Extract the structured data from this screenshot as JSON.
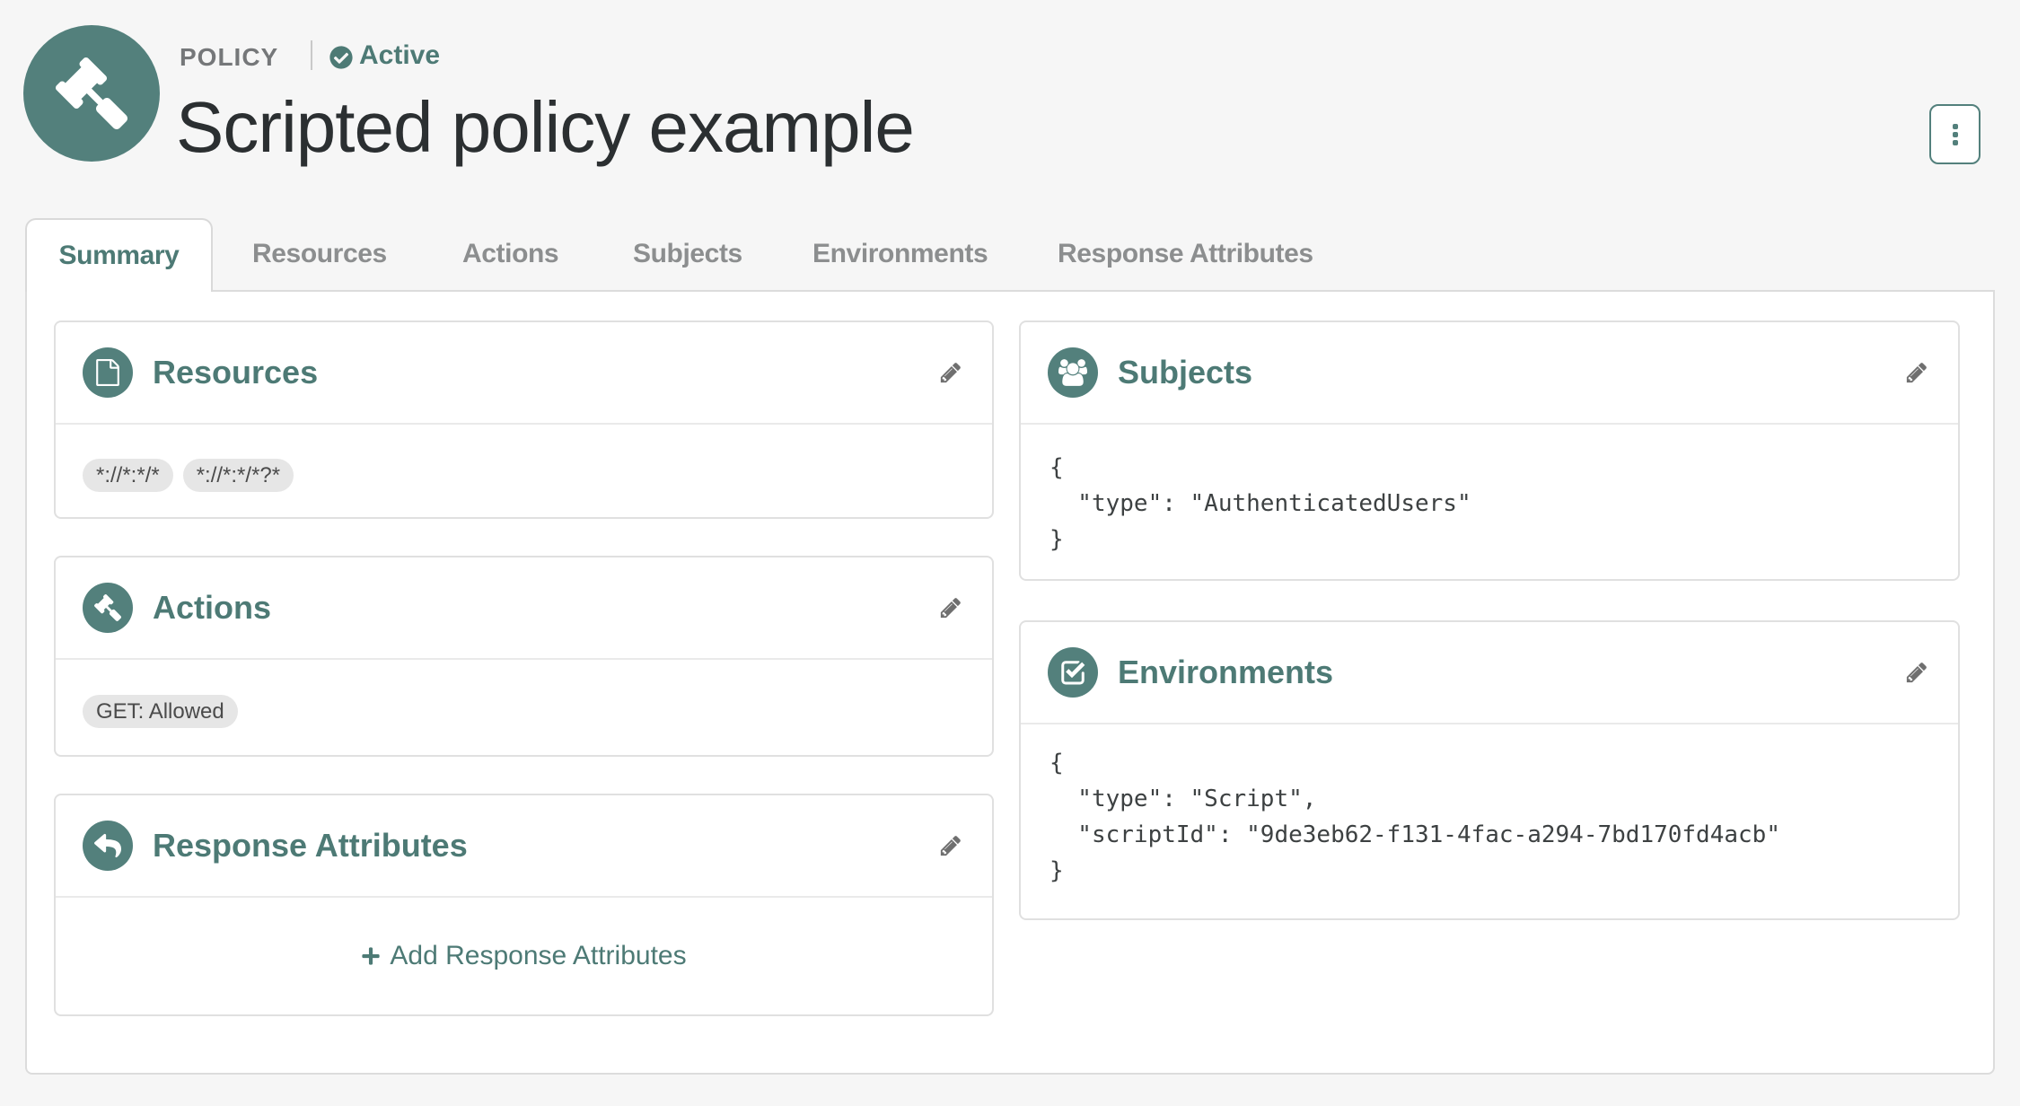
{
  "header": {
    "type_label": "POLICY",
    "status": "Active",
    "title": "Scripted policy example"
  },
  "tabs": [
    {
      "label": "Summary",
      "active": true
    },
    {
      "label": "Resources",
      "active": false
    },
    {
      "label": "Actions",
      "active": false
    },
    {
      "label": "Subjects",
      "active": false
    },
    {
      "label": "Environments",
      "active": false
    },
    {
      "label": "Response Attributes",
      "active": false
    }
  ],
  "cards": {
    "resources": {
      "title": "Resources",
      "badges": [
        "*://*:*/*",
        "*://*:*/*?*"
      ]
    },
    "actions": {
      "title": "Actions",
      "badges": [
        "GET: Allowed"
      ]
    },
    "response_attributes": {
      "title": "Response Attributes",
      "add_label": "Add Response Attributes"
    },
    "subjects": {
      "title": "Subjects",
      "json": "{\n  \"type\": \"AuthenticatedUsers\"\n}"
    },
    "environments": {
      "title": "Environments",
      "json": "{\n  \"type\": \"Script\",\n  \"scriptId\": \"9de3eb62-f131-4fac-a294-7bd170fd4acb\"\n}"
    }
  },
  "colors": {
    "teal": "#53807c",
    "teal_text": "#4d7a75",
    "page_bg": "#f6f6f6"
  }
}
